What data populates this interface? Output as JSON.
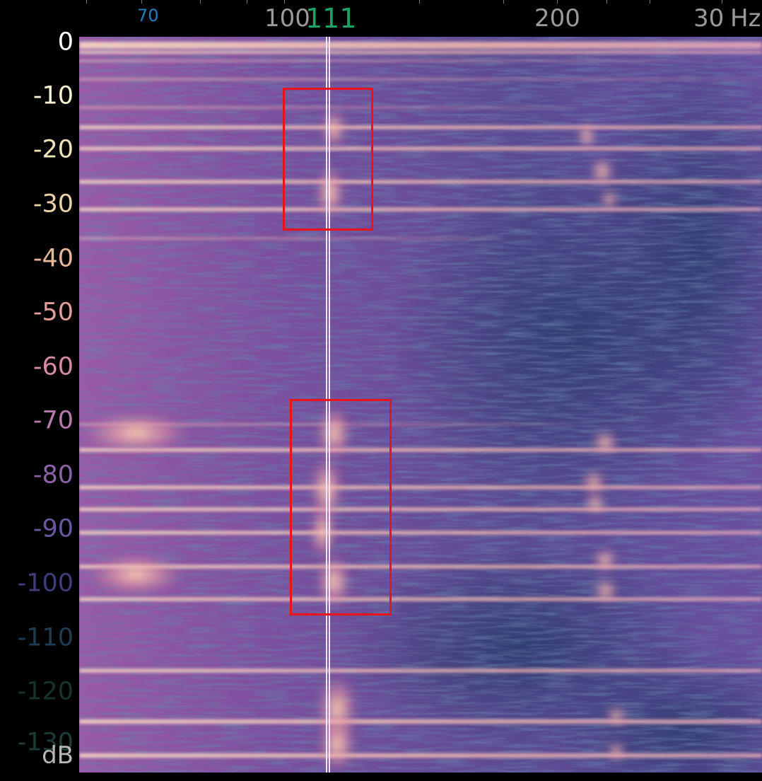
{
  "frequency_axis": {
    "minor_label": {
      "text": "70",
      "color": "#1f7fbf"
    },
    "major_labels": [
      {
        "text": "100",
        "color": "#9a9a9a"
      },
      {
        "text": "200",
        "color": "#9a9a9a"
      },
      {
        "text": "30",
        "color": "#9a9a9a"
      }
    ],
    "cursor_label": {
      "text": "111",
      "color": "#18a464"
    },
    "unit": {
      "text": "Hz",
      "color": "#9a9a9a"
    }
  },
  "db_axis": {
    "labels": [
      {
        "text": "0",
        "color": "#ffffff"
      },
      {
        "text": "-10",
        "color": "#f7f3d0"
      },
      {
        "text": "-20",
        "color": "#f0e5b8"
      },
      {
        "text": "-30",
        "color": "#ecd2a8"
      },
      {
        "text": "-40",
        "color": "#e8b79a"
      },
      {
        "text": "-50",
        "color": "#e29e98"
      },
      {
        "text": "-60",
        "color": "#d88aa0"
      },
      {
        "text": "-70",
        "color": "#b77aae"
      },
      {
        "text": "-80",
        "color": "#8c62a8"
      },
      {
        "text": "-90",
        "color": "#6b56a0"
      },
      {
        "text": "-100",
        "color": "#3c3f7c"
      },
      {
        "text": "-110",
        "color": "#1f3d52"
      },
      {
        "text": "-120",
        "color": "#16332e"
      },
      {
        "text": "-130",
        "color": "#1c3d3a"
      }
    ],
    "unit": {
      "text": "dB",
      "color": "#b8b8b8"
    }
  },
  "colors": {
    "background": "#000000",
    "spectrogram_base": "#5b3f8a",
    "spectrogram_dark": "#2a3d6a",
    "harmonic": "#ffd0bc",
    "cursor": "#f2e6ff",
    "highlight_box": "#e8141a"
  }
}
